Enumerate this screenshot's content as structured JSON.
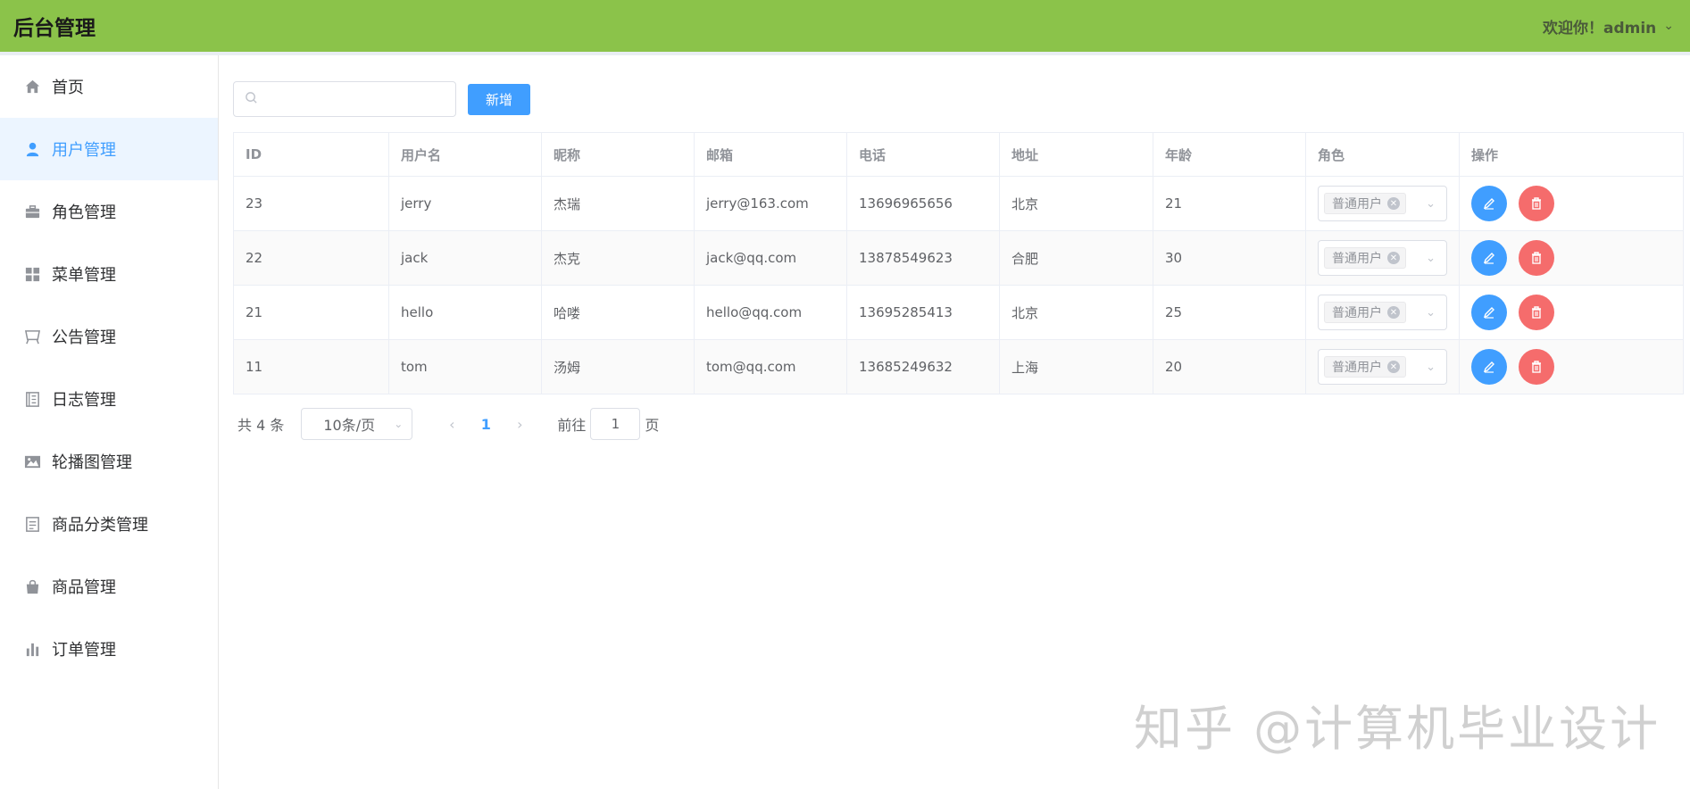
{
  "header": {
    "brand": "后台管理",
    "welcome": "欢迎你！admin"
  },
  "sidebar": {
    "items": [
      {
        "label": "首页",
        "icon": "home-icon"
      },
      {
        "label": "用户管理",
        "icon": "user-icon",
        "active": true
      },
      {
        "label": "角色管理",
        "icon": "briefcase-icon"
      },
      {
        "label": "菜单管理",
        "icon": "grid-icon"
      },
      {
        "label": "公告管理",
        "icon": "board-icon"
      },
      {
        "label": "日志管理",
        "icon": "notebook-icon"
      },
      {
        "label": "轮播图管理",
        "icon": "picture-icon"
      },
      {
        "label": "商品分类管理",
        "icon": "document-icon"
      },
      {
        "label": "商品管理",
        "icon": "shopping-bag-icon"
      },
      {
        "label": "订单管理",
        "icon": "bar-chart-icon"
      }
    ]
  },
  "toolbar": {
    "search_placeholder": "",
    "add_label": "新增"
  },
  "table": {
    "columns": [
      "ID",
      "用户名",
      "昵称",
      "邮箱",
      "电话",
      "地址",
      "年龄",
      "角色",
      "操作"
    ],
    "rows": [
      {
        "id": "23",
        "username": "jerry",
        "nickname": "杰瑞",
        "email": "jerry@163.com",
        "phone": "13696965656",
        "address": "北京",
        "age": "21",
        "role": "普通用户"
      },
      {
        "id": "22",
        "username": "jack",
        "nickname": "杰克",
        "email": "jack@qq.com",
        "phone": "13878549623",
        "address": "合肥",
        "age": "30",
        "role": "普通用户"
      },
      {
        "id": "21",
        "username": "hello",
        "nickname": "哈喽",
        "email": "hello@qq.com",
        "phone": "13695285413",
        "address": "北京",
        "age": "25",
        "role": "普通用户"
      },
      {
        "id": "11",
        "username": "tom",
        "nickname": "汤姆",
        "email": "tom@qq.com",
        "phone": "13685249632",
        "address": "上海",
        "age": "20",
        "role": "普通用户"
      }
    ]
  },
  "pagination": {
    "total_text": "共 4 条",
    "page_size": "10条/页",
    "current_page": "1",
    "goto_prefix": "前往",
    "goto_value": "1",
    "goto_suffix": "页"
  },
  "watermark": "知乎 @计算机毕业设计",
  "colors": {
    "header_bg": "#8bc34a",
    "primary": "#409eff",
    "danger": "#f56c6c",
    "active_bg": "#ecf5ff"
  }
}
